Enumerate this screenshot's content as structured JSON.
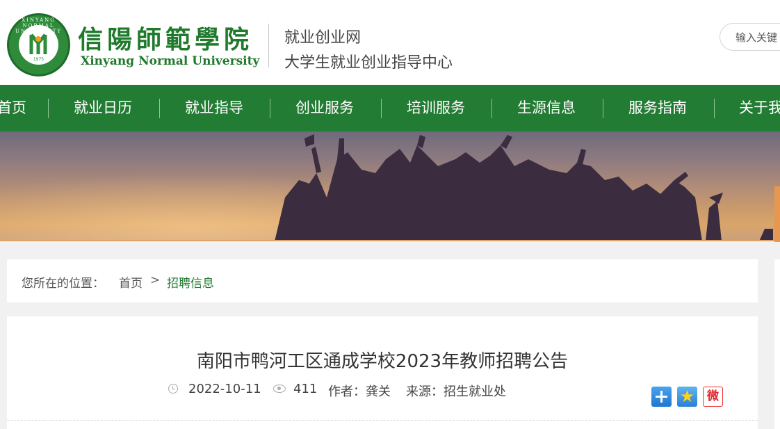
{
  "header": {
    "logo_ring_text": "XINYANG NORMAL UNIVERSITY",
    "logo_year": "1975",
    "university_cn": "信陽師範學院",
    "university_en": "Xinyang Normal University",
    "subtitle_1": "就业创业网",
    "subtitle_2": "大学生就业创业指导中心",
    "search_value": "输入关键",
    "search_placeholder": "输入关键"
  },
  "nav": {
    "items": [
      "首页",
      "就业日历",
      "就业指导",
      "创业服务",
      "培训服务",
      "生源信息",
      "服务指南",
      "关于我"
    ]
  },
  "breadcrumb": {
    "label": "您所在的位置：",
    "home": "首页",
    "separator": ">",
    "current": "招聘信息"
  },
  "article": {
    "title": "南阳市鸭河工区通成学校2023年教师招聘公告",
    "date": "2022-10-11",
    "views": "411",
    "author": "作者：龚关",
    "source": "来源：招生就业处"
  },
  "share": {
    "icons": [
      "share-plus-icon",
      "favorite-star-icon",
      "weibo-icon"
    ],
    "star_glyph": "★",
    "weibo_glyph": "微"
  },
  "colors": {
    "brand_green": "#237c33",
    "accent_orange": "#e7974f"
  }
}
